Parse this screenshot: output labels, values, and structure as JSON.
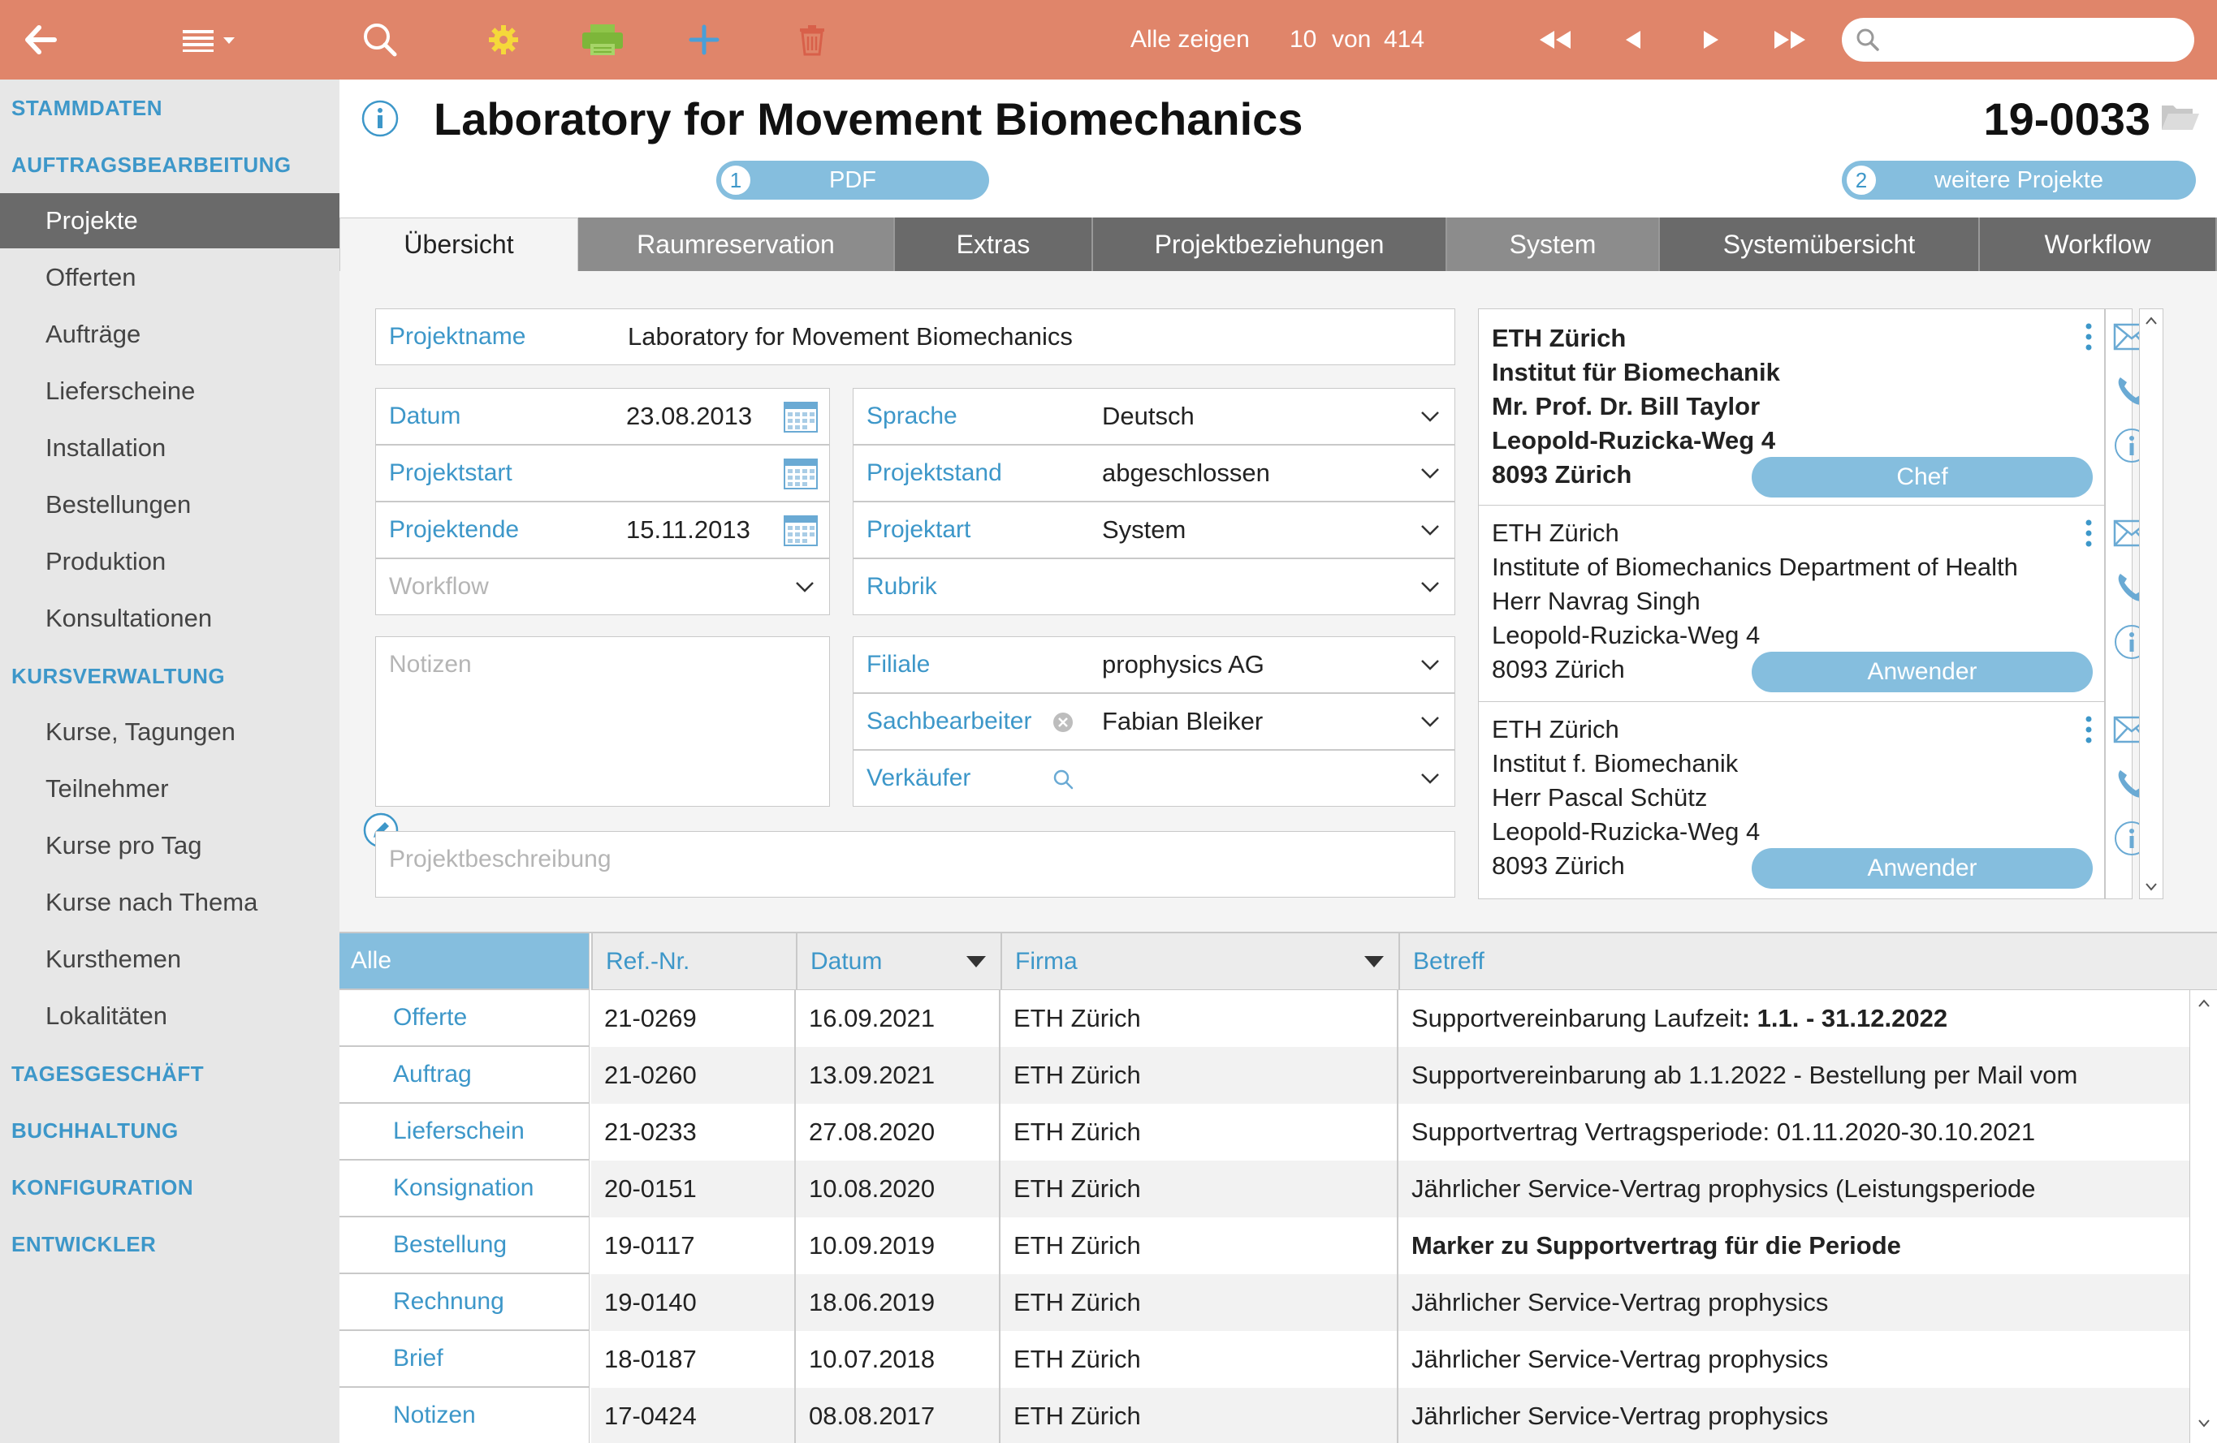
{
  "toolbar": {
    "show_all": "Alle zeigen",
    "count": "10",
    "of": "von",
    "total": "414",
    "search_placeholder": ""
  },
  "sidebar": {
    "sections": [
      {
        "label": "STAMMDATEN"
      },
      {
        "label": "AUFTRAGSBEARBEITUNG"
      },
      {
        "label": "KURSVERWALTUNG"
      },
      {
        "label": "TAGESGESCHÄFT"
      },
      {
        "label": "BUCHHALTUNG"
      },
      {
        "label": "KONFIGURATION"
      },
      {
        "label": "ENTWICKLER"
      }
    ],
    "items": [
      {
        "label": "Projekte"
      },
      {
        "label": "Offerten"
      },
      {
        "label": "Aufträge"
      },
      {
        "label": "Lieferscheine"
      },
      {
        "label": "Installation"
      },
      {
        "label": "Bestellungen"
      },
      {
        "label": "Produktion"
      },
      {
        "label": "Konsultationen"
      },
      {
        "label": "Kurse, Tagungen"
      },
      {
        "label": "Teilnehmer"
      },
      {
        "label": "Kurse pro Tag"
      },
      {
        "label": "Kurse nach Thema"
      },
      {
        "label": "Kursthemen"
      },
      {
        "label": "Lokalitäten"
      }
    ]
  },
  "header": {
    "title": "Laboratory for Movement Biomechanics",
    "project_number": "19-0033",
    "pdf_num": "1",
    "pdf_label": "PDF",
    "more_num": "2",
    "more_label": "weitere Projekte"
  },
  "tabs": [
    {
      "label": "Übersicht"
    },
    {
      "label": "Raumreservation"
    },
    {
      "label": "Extras"
    },
    {
      "label": "Projektbeziehungen"
    },
    {
      "label": "System"
    },
    {
      "label": "Systemübersicht"
    },
    {
      "label": "Workflow"
    }
  ],
  "form": {
    "projektname_label": "Projektname",
    "projektname_value": "Laboratory for Movement Biomechanics",
    "datum_label": "Datum",
    "datum_value": "23.08.2013",
    "projektstart_label": "Projektstart",
    "projektstart_value": "",
    "projektende_label": "Projektende",
    "projektende_value": "15.11.2013",
    "workflow_placeholder": "Workflow",
    "sprache_label": "Sprache",
    "sprache_value": "Deutsch",
    "projektstand_label": "Projektstand",
    "projektstand_value": "abgeschlossen",
    "projektart_label": "Projektart",
    "projektart_value": "System",
    "rubrik_label": "Rubrik",
    "rubrik_value": "",
    "notizen_placeholder": "Notizen",
    "filiale_label": "Filiale",
    "filiale_value": "prophysics AG",
    "sachbearbeiter_label": "Sachbearbeiter",
    "sachbearbeiter_value": "Fabian Bleiker",
    "verkaeufer_label": "Verkäufer",
    "verkaeufer_value": "",
    "beschreibung_placeholder": "Projektbeschreibung"
  },
  "contacts": [
    {
      "lines": [
        "ETH Zürich",
        "Institut für Biomechanik",
        "Mr. Prof. Dr. Bill Taylor",
        "Leopold-Ruzicka-Weg 4",
        "8093 Zürich"
      ],
      "role": "Chef",
      "bold": true
    },
    {
      "lines": [
        "ETH Zürich",
        "Institute of Biomechanics Department of Health",
        "Herr Navrag Singh",
        "Leopold-Ruzicka-Weg 4",
        "8093 Zürich"
      ],
      "role": "Anwender",
      "bold": false
    },
    {
      "lines": [
        "ETH Zürich",
        "Institut f. Biomechanik",
        "Herr Pascal Schütz",
        "Leopold-Ruzicka-Weg 4",
        "8093 Zürich"
      ],
      "role": "Anwender",
      "bold": false
    }
  ],
  "table": {
    "filters": [
      {
        "label": "Alle"
      },
      {
        "label": "Offerte"
      },
      {
        "label": "Auftrag"
      },
      {
        "label": "Lieferschein"
      },
      {
        "label": "Konsignation"
      },
      {
        "label": "Bestellung"
      },
      {
        "label": "Rechnung"
      },
      {
        "label": "Brief"
      },
      {
        "label": "Notizen"
      }
    ],
    "headers": {
      "ref": "Ref.-Nr.",
      "datum": "Datum",
      "firma": "Firma",
      "betreff": "Betreff"
    },
    "rows": [
      {
        "ref": "21-0269",
        "datum": "16.09.2021",
        "firma": "ETH Zürich",
        "betreff": "Supportvereinbarung Laufzeit",
        "betreff_bold": ": 1.1. - 31.12.2022"
      },
      {
        "ref": "21-0260",
        "datum": "13.09.2021",
        "firma": "ETH Zürich",
        "betreff": "Supportvereinbarung ab 1.1.2022 - Bestellung per Mail vom",
        "betreff_bold": ""
      },
      {
        "ref": "21-0233",
        "datum": "27.08.2020",
        "firma": "ETH Zürich",
        "betreff": "Supportvertrag Vertragsperiode: 01.11.2020-30.10.2021",
        "betreff_bold": ""
      },
      {
        "ref": "20-0151",
        "datum": "10.08.2020",
        "firma": "ETH Zürich",
        "betreff": "Jährlicher Service-Vertrag prophysics (Leistungsperiode",
        "betreff_bold": ""
      },
      {
        "ref": "19-0117",
        "datum": "10.09.2019",
        "firma": "ETH Zürich",
        "betreff": "",
        "betreff_bold": "Marker zu Supportvertrag für die Periode"
      },
      {
        "ref": "19-0140",
        "datum": "18.06.2019",
        "firma": "ETH Zürich",
        "betreff": "Jährlicher Service-Vertrag prophysics",
        "betreff_bold": ""
      },
      {
        "ref": "18-0187",
        "datum": "10.07.2018",
        "firma": "ETH Zürich",
        "betreff": "Jährlicher Service-Vertrag prophysics",
        "betreff_bold": ""
      },
      {
        "ref": "17-0424",
        "datum": "08.08.2017",
        "firma": "ETH Zürich",
        "betreff": "Jährlicher Service-Vertrag prophysics",
        "betreff_bold": ""
      }
    ]
  }
}
